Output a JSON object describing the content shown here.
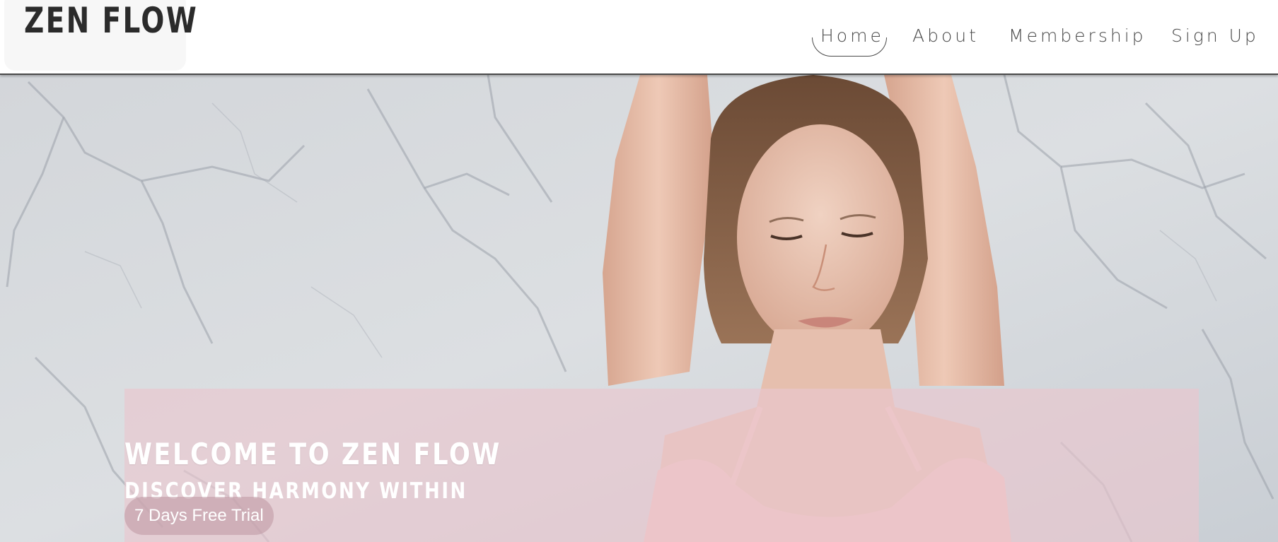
{
  "brand": {
    "logo_text": "ZEN FLOW"
  },
  "nav": {
    "items": [
      {
        "label": "Home",
        "active": true
      },
      {
        "label": "About",
        "active": false
      },
      {
        "label": "Membership",
        "active": false
      },
      {
        "label": "Sign Up",
        "active": false
      }
    ]
  },
  "hero": {
    "title": "WELCOME TO ZEN FLOW",
    "subtitle": "DISCOVER HARMONY WITHIN",
    "cta_label": "7 Days Free Trial",
    "image": "woman-meditating-arms-raised-marble-wall"
  },
  "colors": {
    "header_bg": "#ffffff",
    "overlay": "#e9c6ce",
    "text_dark": "#2b2b2b",
    "nav_text": "#4a4a4a",
    "hero_text": "#ffffff"
  }
}
